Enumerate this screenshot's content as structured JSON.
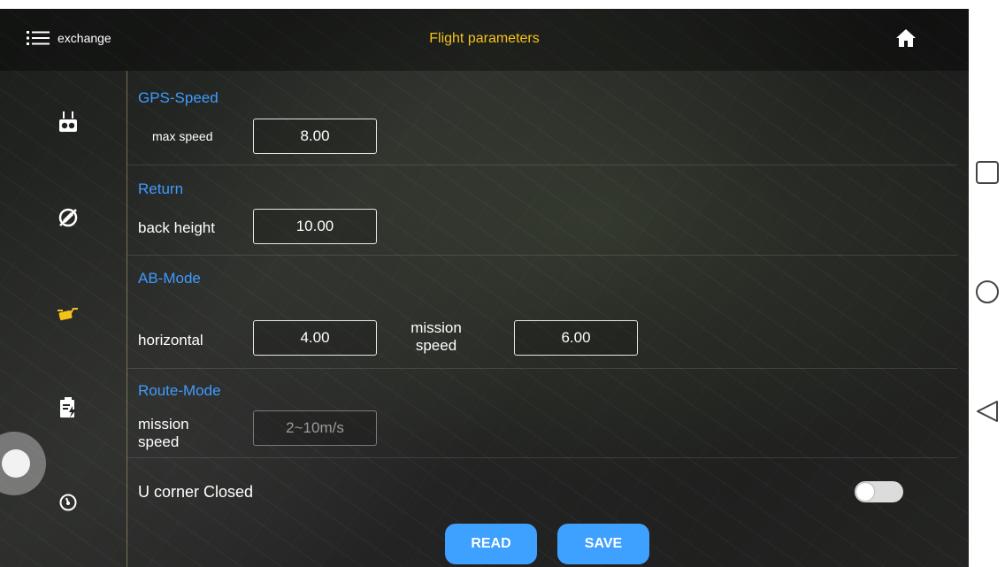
{
  "header": {
    "menu_label": "exchange",
    "title": "Flight parameters",
    "menu_icon": "list-icon",
    "home_icon": "home-icon"
  },
  "sidebar": {
    "items": [
      {
        "icon": "remote-controller-icon",
        "color": "#ffffff"
      },
      {
        "icon": "compass-icon",
        "color": "#ffffff"
      },
      {
        "icon": "drone-icon",
        "color": "#f6c21a"
      },
      {
        "icon": "battery-clipboard-icon",
        "color": "#ffffff"
      },
      {
        "icon": "gauge-icon",
        "color": "#ffffff"
      }
    ]
  },
  "sections": {
    "gps_speed": {
      "title": "GPS-Speed",
      "max_speed_label": "max speed",
      "max_speed_value": "8.00"
    },
    "return": {
      "title": "Return",
      "back_height_label": "back height",
      "back_height_value": "10.00"
    },
    "ab_mode": {
      "title": "AB-Mode",
      "horizontal_label": "horizontal",
      "horizontal_value": "4.00",
      "mission_speed_label_1": "mission",
      "mission_speed_label_2": "speed",
      "mission_speed_value": "6.00"
    },
    "route_mode": {
      "title": "Route-Mode",
      "mission_speed_label_1": "mission",
      "mission_speed_label_2": "speed",
      "mission_speed_placeholder": "2~10m/s"
    },
    "u_corner": {
      "label": "U corner Closed",
      "enabled": false
    }
  },
  "buttons": {
    "read": "READ",
    "save": "SAVE"
  },
  "colors": {
    "accent_blue": "#3ea0ff",
    "title_yellow": "#f6c21a",
    "section_blue": "#3f9bff"
  },
  "system_nav": {
    "recents": "square-icon",
    "home": "circle-icon",
    "back": "triangle-icon"
  }
}
